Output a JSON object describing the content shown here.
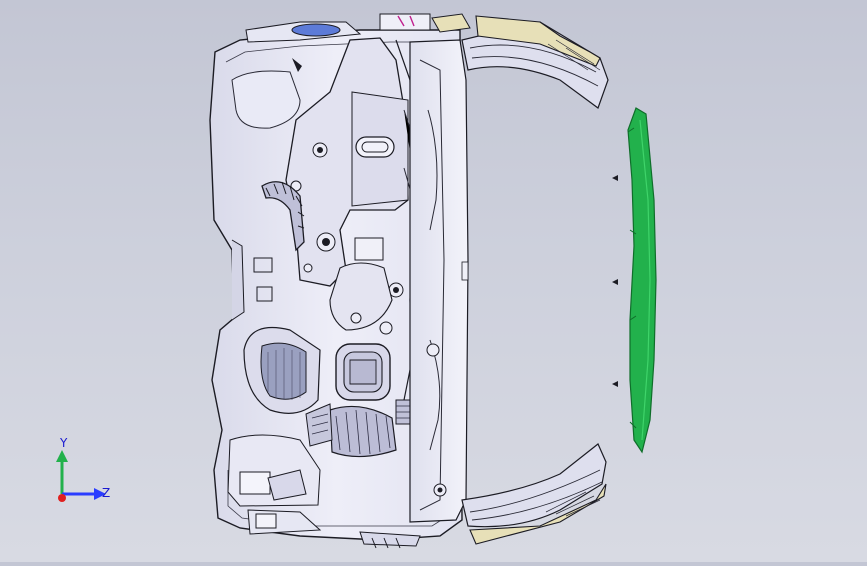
{
  "viewport": {
    "background_top": "#c3c6d4",
    "background_bottom": "#d8dae3"
  },
  "model": {
    "body_fill": "#e6e7f3",
    "edge_color": "#1c1c24",
    "highlight_color": "#22b14c",
    "bracket_fill": "#e7e0b8"
  },
  "triad": {
    "y_label": "Y",
    "z_label": "Z",
    "y_color": "#22b14c",
    "z_color": "#2a3cff",
    "x_color": "#e0201f"
  }
}
